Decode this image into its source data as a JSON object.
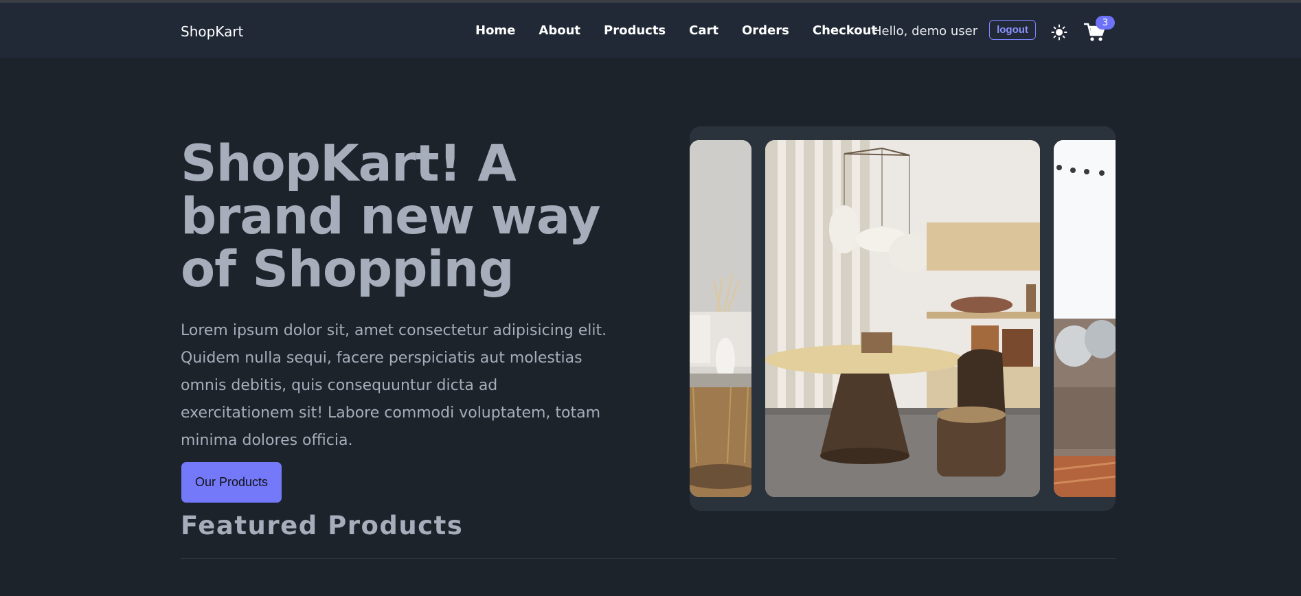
{
  "brand": "ShopKart",
  "nav": [
    {
      "label": "Home"
    },
    {
      "label": "About"
    },
    {
      "label": "Products"
    },
    {
      "label": "Cart"
    },
    {
      "label": "Orders"
    },
    {
      "label": "Checkout"
    }
  ],
  "user": {
    "greeting": "Hello, demo user",
    "logout_label": "logout"
  },
  "cart": {
    "count": "3"
  },
  "icons": {
    "theme": "sun-icon",
    "cart": "cart-icon"
  },
  "hero": {
    "title": "ShopKart! A brand new way of Shopping",
    "description": "Lorem ipsum dolor sit, amet consectetur adipisicing elit. Quidem nulla sequi, facere perspiciatis aut molestias omnis debitis, quis consequuntur dicta ad exercitationem sit! Labore commodi voluptatem, totam minima dolores officia.",
    "button_label": "Our Products"
  },
  "featured": {
    "title": "Featured Products"
  },
  "colors": {
    "background": "#1d232a",
    "navbar": "#212936",
    "accent": "#7479fa",
    "text": "#a6adbb"
  }
}
